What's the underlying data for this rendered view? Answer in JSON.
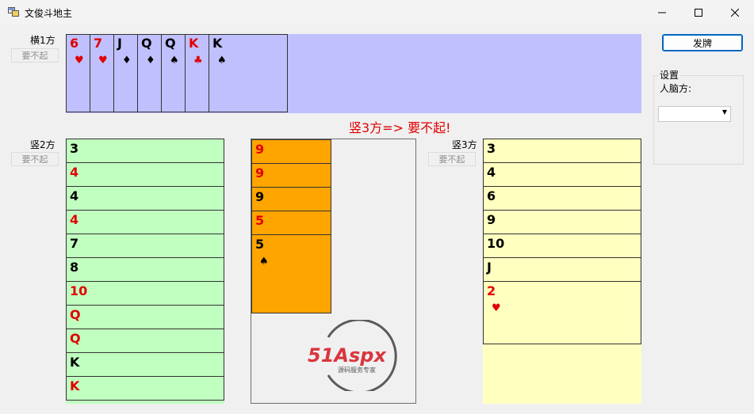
{
  "window": {
    "title": "文俊斗地主"
  },
  "players": {
    "top": {
      "label": "横1方",
      "pass_button": "要不起",
      "cards": [
        {
          "rank": "6",
          "suit": "♥",
          "color": "red"
        },
        {
          "rank": "7",
          "suit": "♥",
          "color": "red"
        },
        {
          "rank": "J",
          "suit": "♦",
          "color": "black"
        },
        {
          "rank": "Q",
          "suit": "♦",
          "color": "black"
        },
        {
          "rank": "Q",
          "suit": "♠",
          "color": "black"
        },
        {
          "rank": "K",
          "suit": "♣",
          "color": "red"
        },
        {
          "rank": "K",
          "suit": "♠",
          "color": "black"
        }
      ]
    },
    "left": {
      "label": "竖2方",
      "pass_button": "要不起",
      "cards": [
        {
          "rank": "3",
          "suit": "",
          "color": "black"
        },
        {
          "rank": "4",
          "suit": "",
          "color": "red"
        },
        {
          "rank": "4",
          "suit": "",
          "color": "black"
        },
        {
          "rank": "4",
          "suit": "",
          "color": "red"
        },
        {
          "rank": "7",
          "suit": "",
          "color": "black"
        },
        {
          "rank": "8",
          "suit": "",
          "color": "black"
        },
        {
          "rank": "10",
          "suit": "",
          "color": "red"
        },
        {
          "rank": "Q",
          "suit": "",
          "color": "red"
        },
        {
          "rank": "Q",
          "suit": "",
          "color": "red"
        },
        {
          "rank": "K",
          "suit": "",
          "color": "black"
        },
        {
          "rank": "K",
          "suit": "",
          "color": "red"
        }
      ]
    },
    "right": {
      "label": "竖3方",
      "pass_button": "要不起",
      "cards": [
        {
          "rank": "3",
          "suit": "",
          "color": "black"
        },
        {
          "rank": "4",
          "suit": "",
          "color": "black"
        },
        {
          "rank": "6",
          "suit": "",
          "color": "black"
        },
        {
          "rank": "9",
          "suit": "",
          "color": "black"
        },
        {
          "rank": "10",
          "suit": "",
          "color": "black"
        },
        {
          "rank": "J",
          "suit": "",
          "color": "black"
        },
        {
          "rank": "2",
          "suit": "♥",
          "color": "red"
        }
      ]
    }
  },
  "played": {
    "cards": [
      {
        "rank": "9",
        "suit": "",
        "color": "red"
      },
      {
        "rank": "9",
        "suit": "",
        "color": "red"
      },
      {
        "rank": "9",
        "suit": "",
        "color": "black"
      },
      {
        "rank": "5",
        "suit": "",
        "color": "red"
      },
      {
        "rank": "5",
        "suit": "♠",
        "color": "black"
      }
    ]
  },
  "status_message": "竖3方=>  要不起!",
  "controls": {
    "deal_button": "发牌",
    "settings_title": "设置",
    "ai_label": "人脑方:",
    "ai_selected": ""
  },
  "watermark": {
    "brand": "51Aspx",
    "tagline": "源码服务专家"
  },
  "colors": {
    "red_card": "#e00000",
    "top_hand_bg": "#c0c0ff",
    "left_hand_bg": "#c0ffc0",
    "right_hand_bg": "#ffffc0",
    "played_card_bg": "#ffa500"
  }
}
